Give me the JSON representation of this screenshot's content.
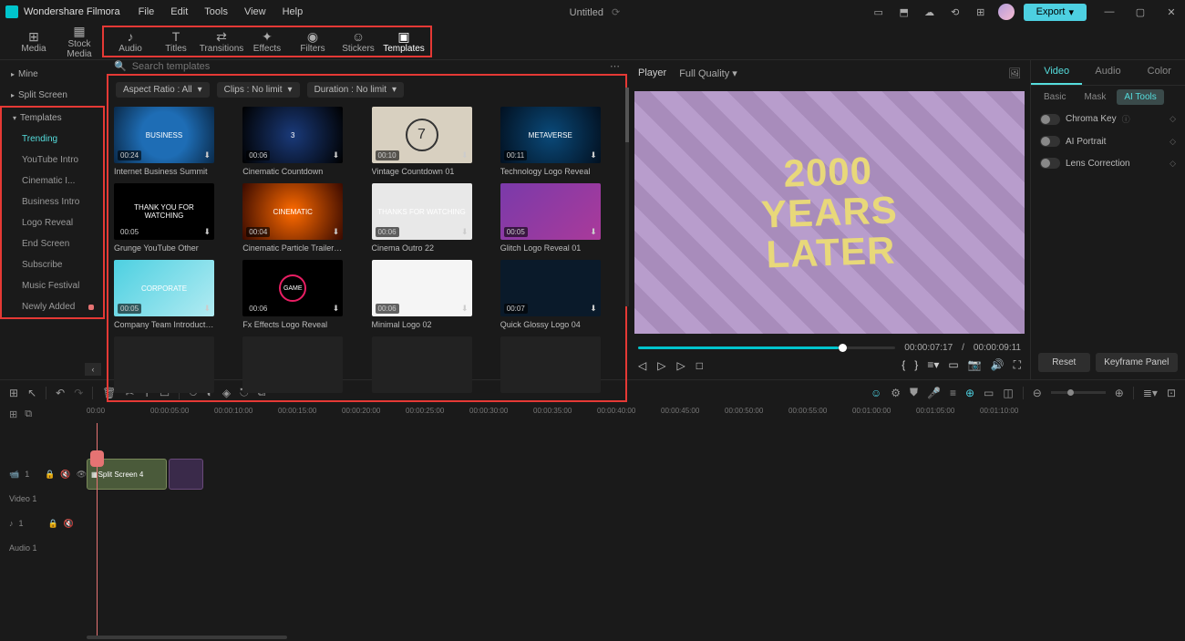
{
  "app": {
    "name": "Wondershare Filmora",
    "title": "Untitled"
  },
  "menu": [
    "File",
    "Edit",
    "Tools",
    "View",
    "Help"
  ],
  "export_label": "Export",
  "media_tabs": [
    {
      "label": "Media",
      "icon": "⊞"
    },
    {
      "label": "Stock Media",
      "icon": "▦"
    },
    {
      "label": "Audio",
      "icon": "♪"
    },
    {
      "label": "Titles",
      "icon": "T"
    },
    {
      "label": "Transitions",
      "icon": "⇄"
    },
    {
      "label": "Effects",
      "icon": "✦"
    },
    {
      "label": "Filters",
      "icon": "◉"
    },
    {
      "label": "Stickers",
      "icon": "☺"
    },
    {
      "label": "Templates",
      "icon": "▣"
    }
  ],
  "sidebar_top": [
    {
      "label": "Mine"
    },
    {
      "label": "Split Screen"
    }
  ],
  "sidebar_section": "Templates",
  "sidebar_subs": [
    {
      "label": "Trending",
      "active": true
    },
    {
      "label": "YouTube Intro"
    },
    {
      "label": "Cinematic I..."
    },
    {
      "label": "Business Intro"
    },
    {
      "label": "Logo Reveal"
    },
    {
      "label": "End Screen"
    },
    {
      "label": "Subscribe"
    },
    {
      "label": "Music Festival"
    },
    {
      "label": "Newly Added",
      "badge": true
    }
  ],
  "search_placeholder": "Search templates",
  "filters": [
    {
      "label": "Aspect Ratio : All"
    },
    {
      "label": "Clips : No limit"
    },
    {
      "label": "Duration : No limit"
    }
  ],
  "templates": [
    {
      "title": "Internet Business Summit",
      "dur": "00:24",
      "cls": "th-biz",
      "text": "BUSINESS"
    },
    {
      "title": "Cinematic Countdown",
      "dur": "00:06",
      "cls": "th-count",
      "text": "3"
    },
    {
      "title": "Vintage Countdown 01",
      "dur": "00:10",
      "cls": "th-vintage",
      "text": "7"
    },
    {
      "title": "Technology Logo Reveal",
      "dur": "00:11",
      "cls": "th-tech",
      "text": "METAVERSE"
    },
    {
      "title": "Grunge YouTube Other",
      "dur": "00:05",
      "cls": "th-grunge",
      "text": "THANK YOU FOR WATCHING"
    },
    {
      "title": "Cinematic Particle Trailer 01",
      "dur": "00:04",
      "cls": "th-cinematic",
      "text": "CINEMATIC"
    },
    {
      "title": "Cinema Outro 22",
      "dur": "00:06",
      "cls": "th-outro",
      "text": "THANKS FOR WATCHING"
    },
    {
      "title": "Glitch Logo Reveal 01",
      "dur": "00:05",
      "cls": "th-glitch",
      "text": ""
    },
    {
      "title": "Company Team Introduction",
      "dur": "00:05",
      "cls": "th-corp",
      "text": "CORPORATE"
    },
    {
      "title": "Fx Effects Logo Reveal",
      "dur": "00:06",
      "cls": "th-fx",
      "text": "GAME"
    },
    {
      "title": "Minimal Logo 02",
      "dur": "00:06",
      "cls": "th-minimal",
      "text": ""
    },
    {
      "title": "Quick Glossy Logo 04",
      "dur": "00:07",
      "cls": "th-glossy",
      "text": ""
    },
    {
      "title": "",
      "dur": "",
      "cls": "th-placeholder",
      "text": ""
    },
    {
      "title": "",
      "dur": "",
      "cls": "th-placeholder",
      "text": ""
    },
    {
      "title": "",
      "dur": "",
      "cls": "th-placeholder",
      "text": ""
    },
    {
      "title": "",
      "dur": "",
      "cls": "th-placeholder",
      "text": ""
    }
  ],
  "preview": {
    "player_label": "Player",
    "quality": "Full Quality",
    "title_text": "2000\nYEARS\nLATER",
    "time_current": "00:00:07:17",
    "time_sep": "/",
    "time_total": "00:00:09:11"
  },
  "props": {
    "tabs": [
      "Video",
      "Audio",
      "Color"
    ],
    "subtabs": [
      "Basic",
      "Mask",
      "AI Tools"
    ],
    "rows": [
      {
        "label": "Chroma Key",
        "info": true
      },
      {
        "label": "AI Portrait"
      },
      {
        "label": "Lens Correction"
      }
    ],
    "reset": "Reset",
    "keyframe": "Keyframe Panel"
  },
  "ruler_ticks": [
    "00:00",
    "00:00:05:00",
    "00:00:10:00",
    "00:00:15:00",
    "00:00:20:00",
    "00:00:25:00",
    "00:00:30:00",
    "00:00:35:00",
    "00:00:40:00",
    "00:00:45:00",
    "00:00:50:00",
    "00:00:55:00",
    "00:01:00:00",
    "00:01:05:00",
    "00:01:10:00"
  ],
  "tracks": {
    "video": {
      "name": "Video 1",
      "icon_label": "1"
    },
    "audio": {
      "name": "Audio 1",
      "icon_label": "1"
    },
    "clip_ss": "Split Screen 4"
  }
}
